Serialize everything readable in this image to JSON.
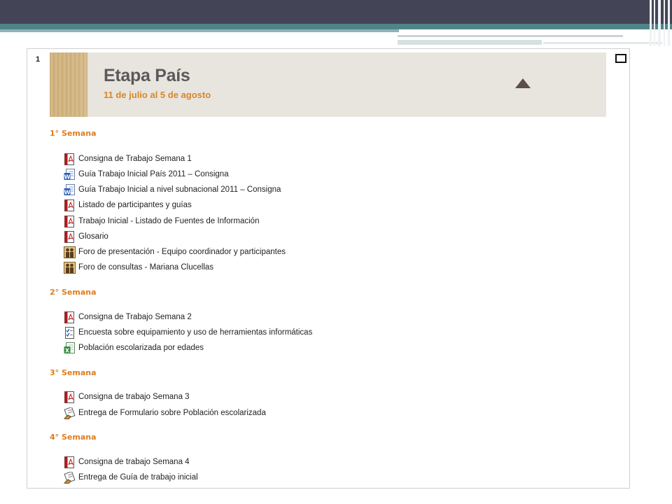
{
  "section": {
    "number": "1",
    "banner_title": "Etapa País",
    "banner_subtitle": "11 de julio al 5 de agosto"
  },
  "colors": {
    "week_heading": "#e07d1f",
    "slide_dark": "#434556",
    "slide_teal": "#4f8488"
  },
  "weeks": [
    {
      "title": "1° Semana",
      "items": [
        {
          "icon": "pdf-icon",
          "label": "Consigna de Trabajo Semana 1"
        },
        {
          "icon": "word-doc-icon",
          "label": "Guía Trabajo Inicial País 2011 – Consigna"
        },
        {
          "icon": "word-doc-icon",
          "label": "Guía Trabajo Inicial a nivel subnacional 2011 – Consigna"
        },
        {
          "icon": "pdf-icon",
          "label": "Listado de participantes y guías"
        },
        {
          "icon": "pdf-icon",
          "label": "Trabajo Inicial - Listado de Fuentes de Información"
        },
        {
          "icon": "pdf-icon",
          "label": "Glosario"
        },
        {
          "icon": "forum-icon",
          "label": "Foro de presentación - Equipo coordinador y participantes"
        },
        {
          "icon": "forum-icon",
          "label": "Foro de consultas - Mariana Clucellas"
        }
      ]
    },
    {
      "title": "2° Semana",
      "items": [
        {
          "icon": "pdf-icon",
          "label": "Consigna de Trabajo Semana 2"
        },
        {
          "icon": "survey-icon",
          "label": "Encuesta sobre equipamiento y uso de herramientas informáticas"
        },
        {
          "icon": "excel-icon",
          "label": "Población escolarizada por edades"
        }
      ]
    },
    {
      "title": "3° Semana",
      "items": [
        {
          "icon": "pdf-icon",
          "label": "Consigna de trabajo Semana 3"
        },
        {
          "icon": "assignment-icon",
          "label": "Entrega de Formulario sobre Población escolarizada"
        }
      ]
    },
    {
      "title": "4° Semana",
      "items": [
        {
          "icon": "pdf-icon",
          "label": "Consigna de trabajo Semana 4"
        },
        {
          "icon": "assignment-icon",
          "label": "Entrega de Guía de trabajo inicial"
        }
      ]
    }
  ]
}
